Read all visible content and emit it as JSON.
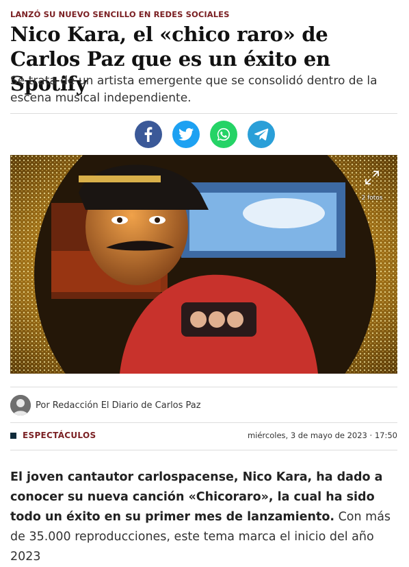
{
  "article": {
    "kicker": "LANZÓ SU NUEVO SENCILLO EN REDES SOCIALES",
    "title": "Nico Kara, el «chico raro» de Carlos Paz que es un éxito en Spotify",
    "subtitle": "Se trata de un artista emergente que se consolidó dentro de la escena musical independiente.",
    "photo_count": "2 fotos",
    "byline": "Por Redacción El Diario de Carlos Paz",
    "section": "ESPECTÁCULOS",
    "date": "miércoles, 3 de mayo de 2023 · 17:50",
    "lead_bold": "El joven cantautor carlospacense, Nico Kara, ha dado a conocer su nueva canción «Chicoraro», la cual ha sido todo un éxito en su primer mes de lanzamiento.",
    "lead_rest": " Con más de 35.000 reproducciones, este tema marca el inicio del año 2023"
  },
  "share": [
    {
      "icon": "facebook-icon",
      "color": "#3b5998"
    },
    {
      "icon": "twitter-icon",
      "color": "#1da1f2"
    },
    {
      "icon": "whatsapp-icon",
      "color": "#25d366"
    },
    {
      "icon": "telegram-icon",
      "color": "#2a9fd8"
    }
  ],
  "colors": {
    "accent": "#7a1f22",
    "section_marker": "#0f2a3a"
  }
}
